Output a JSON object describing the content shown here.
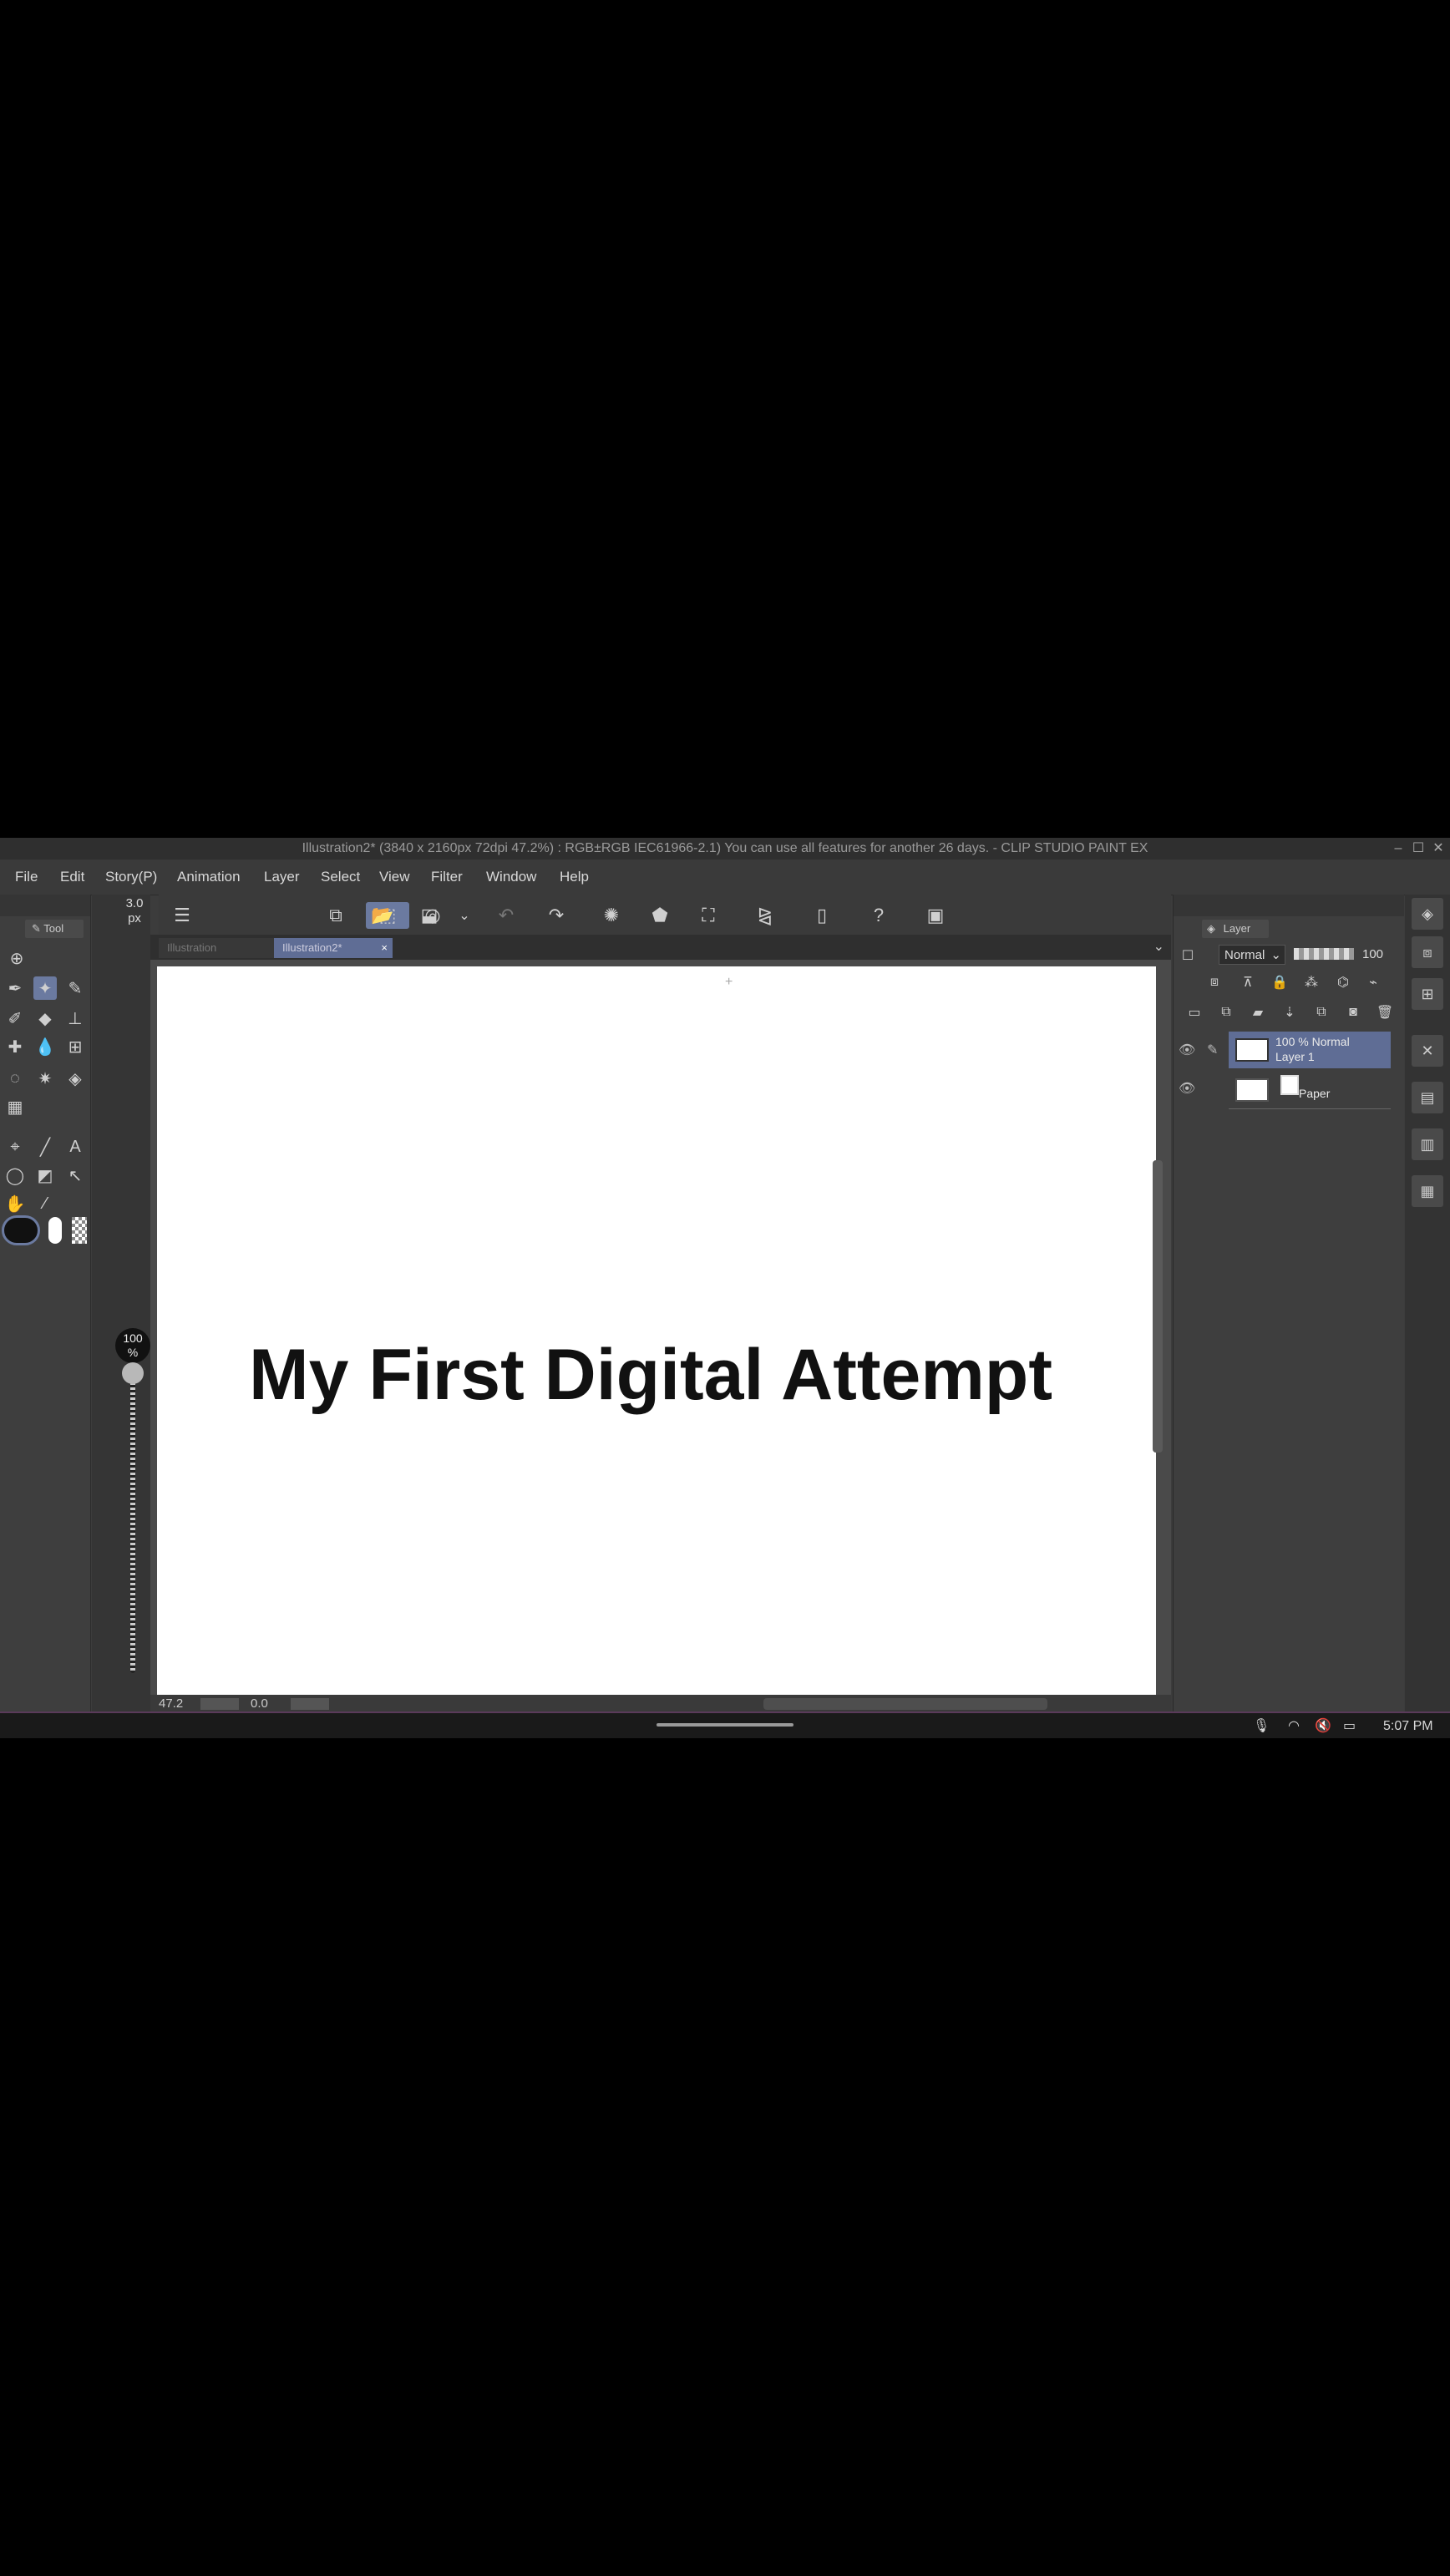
{
  "window": {
    "title": "Illustration2* (3840 x 2160px 72dpi 47.2%) : RGB±RGB IEC61966-2.1)  You can use all features for another 26 days. - CLIP STUDIO PAINT EX"
  },
  "menu": {
    "items": [
      "File",
      "Edit",
      "Story(P)",
      "Animation",
      "Layer",
      "Select",
      "View",
      "Filter",
      "Window",
      "Help"
    ]
  },
  "tool_panel": {
    "tab_label": "Tool"
  },
  "brush": {
    "size": "3.0",
    "size_unit": "px",
    "opacity": "100",
    "opacity_unit": "%"
  },
  "document_tabs": [
    {
      "label": "Illustration"
    },
    {
      "label": "Illustration2*"
    }
  ],
  "canvas": {
    "text": "My First Digital Attempt"
  },
  "status": {
    "zoom": "47.2",
    "rotation": "0.0"
  },
  "layer_panel": {
    "tab_label": "Layer",
    "blend_mode": "Normal",
    "opacity": "100",
    "layers": [
      {
        "mode": "100 % Normal",
        "name": "Layer 1",
        "selected": true
      },
      {
        "name": "Paper",
        "selected": false
      }
    ]
  },
  "taskbar": {
    "time": "5:07 PM"
  },
  "colors": {
    "accent": "#5f6d95",
    "panel": "#3e3e3e",
    "background": "#000000"
  }
}
